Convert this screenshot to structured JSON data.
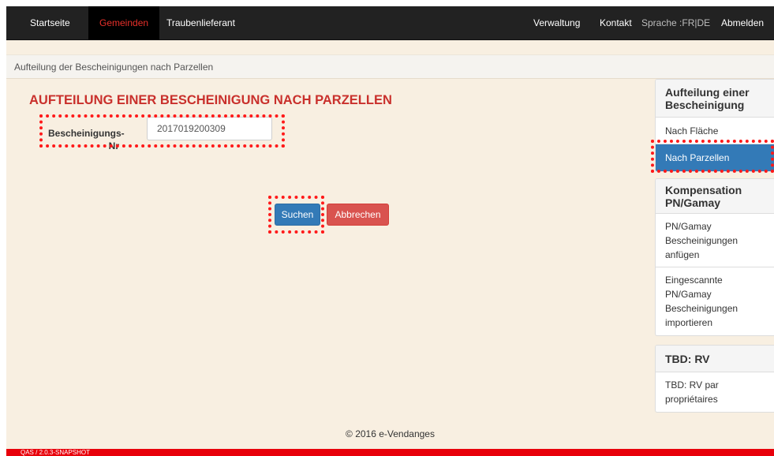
{
  "nav": {
    "left": [
      {
        "label": "Startseite"
      },
      {
        "label": "Gemeinden"
      },
      {
        "label": "Traubenlieferant"
      }
    ],
    "right": {
      "verwaltung": "Verwaltung",
      "kontakt": "Kontakt",
      "sprache": "Sprache :FR|DE",
      "abmelden": "Abmelden"
    }
  },
  "breadcrumb": "Aufteilung der Bescheinigungen nach Parzellen",
  "page_title": "AUFTEILUNG EINER BESCHEINIGUNG NACH PARZELLEN",
  "form": {
    "label": "Bescheinigungs-Nr",
    "value": "2017019200309",
    "search_button": "Suchen",
    "cancel_button": "Abbrechen"
  },
  "sidebar": {
    "panels": [
      {
        "heading": "Aufteilung einer Bescheinigung",
        "items": [
          "Nach Fläche",
          "Nach Parzellen"
        ]
      },
      {
        "heading": "Kompensation PN/Gamay",
        "items": [
          "PN/Gamay Bescheinigungen anfügen",
          "Eingescannte PN/Gamay Bescheinigungen importieren"
        ]
      },
      {
        "heading": "TBD: RV",
        "items": [
          "TBD: RV par propriétaires"
        ]
      }
    ]
  },
  "footer": "© 2016 e-Vendanges",
  "version": "QAS / 2.0.3-SNAPSHOT",
  "colors": {
    "navbar": "#222222",
    "active_nav_text": "#e8302a",
    "title": "#c9302c",
    "primary": "#337ab7",
    "danger": "#d9534f",
    "annotation": "#ff1a1a",
    "page_bg": "#f8efe1",
    "status_bar": "#e8000b"
  }
}
